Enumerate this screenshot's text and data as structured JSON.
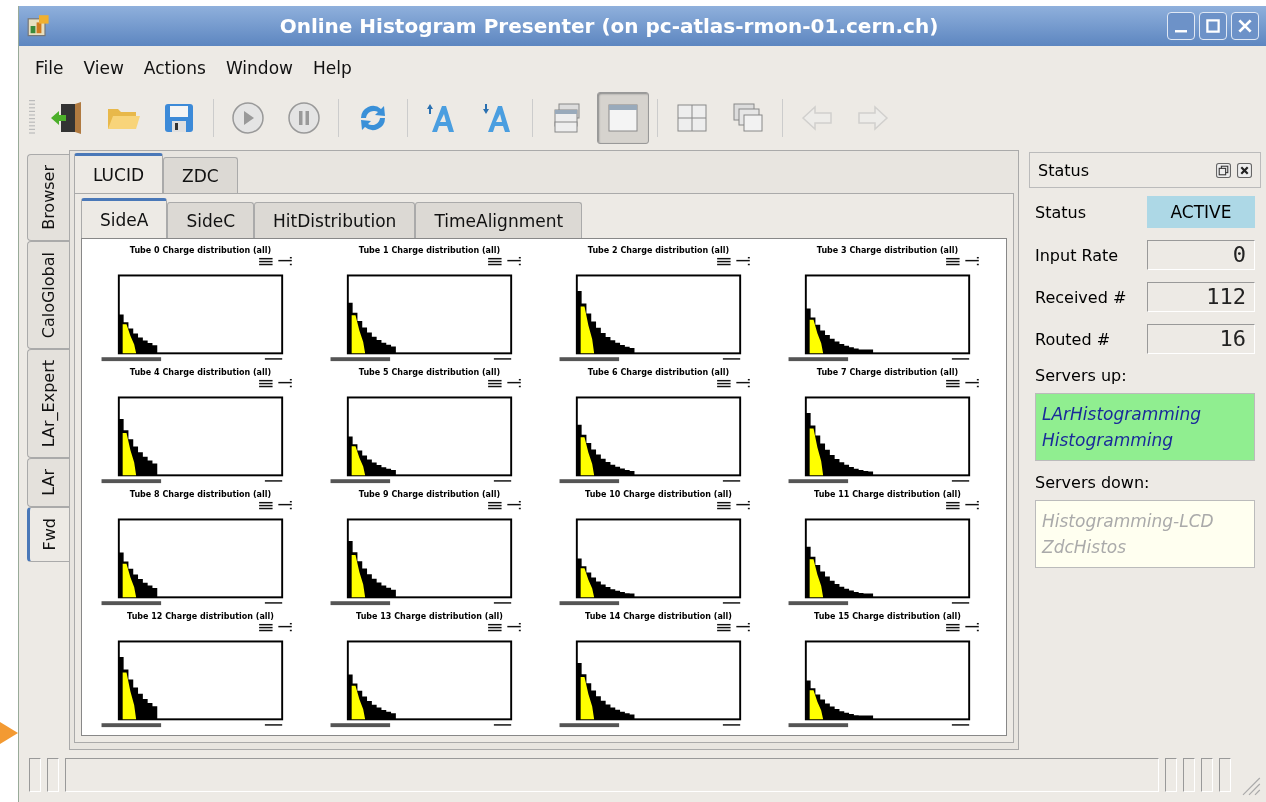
{
  "window": {
    "title": "Online Histogram Presenter (on pc-atlas-rmon-01.cern.ch)"
  },
  "menu": [
    "File",
    "View",
    "Actions",
    "Window",
    "Help"
  ],
  "toolbar": [
    {
      "kind": "exit",
      "pressed": false,
      "disabled": false
    },
    {
      "kind": "open",
      "pressed": false,
      "disabled": false
    },
    {
      "kind": "save",
      "pressed": false,
      "disabled": false
    },
    {
      "kind": "sep"
    },
    {
      "kind": "play",
      "pressed": false,
      "disabled": false
    },
    {
      "kind": "pause",
      "pressed": false,
      "disabled": false
    },
    {
      "kind": "sep"
    },
    {
      "kind": "refresh",
      "pressed": false,
      "disabled": false
    },
    {
      "kind": "sep"
    },
    {
      "kind": "fontup",
      "pressed": false,
      "disabled": false
    },
    {
      "kind": "fontdown",
      "pressed": false,
      "disabled": false
    },
    {
      "kind": "sep"
    },
    {
      "kind": "stack",
      "pressed": false,
      "disabled": false
    },
    {
      "kind": "single",
      "pressed": true,
      "disabled": false
    },
    {
      "kind": "sep"
    },
    {
      "kind": "tile",
      "pressed": false,
      "disabled": false
    },
    {
      "kind": "cascade",
      "pressed": false,
      "disabled": false
    },
    {
      "kind": "sep"
    },
    {
      "kind": "back",
      "pressed": false,
      "disabled": true
    },
    {
      "kind": "forward",
      "pressed": false,
      "disabled": true
    }
  ],
  "side_tabs": [
    {
      "label": "Browser",
      "selected": false
    },
    {
      "label": "CaloGlobal",
      "selected": false
    },
    {
      "label": "LAr_Expert",
      "selected": false
    },
    {
      "label": "LAr",
      "selected": false
    },
    {
      "label": "Fwd",
      "selected": true
    }
  ],
  "tabs": [
    {
      "label": "LUCID",
      "selected": true
    },
    {
      "label": "ZDC",
      "selected": false
    }
  ],
  "sub_tabs": [
    {
      "label": "SideA",
      "selected": true
    },
    {
      "label": "SideC",
      "selected": false
    },
    {
      "label": "HitDistribution",
      "selected": false
    },
    {
      "label": "TimeAlignment",
      "selected": false
    }
  ],
  "histograms": [
    {
      "title": "Tube 0 Charge distribution (all)"
    },
    {
      "title": "Tube 1 Charge distribution (all)"
    },
    {
      "title": "Tube 2 Charge distribution (all)"
    },
    {
      "title": "Tube 3 Charge distribution (all)"
    },
    {
      "title": "Tube 4 Charge distribution (all)"
    },
    {
      "title": "Tube 5 Charge distribution (all)"
    },
    {
      "title": "Tube 6 Charge distribution (all)"
    },
    {
      "title": "Tube 7 Charge distribution (all)"
    },
    {
      "title": "Tube 8 Charge distribution (all)"
    },
    {
      "title": "Tube 9 Charge distribution (all)"
    },
    {
      "title": "Tube 10 Charge distribution (all)"
    },
    {
      "title": "Tube 11 Charge distribution (all)"
    },
    {
      "title": "Tube 12 Charge distribution (all)"
    },
    {
      "title": "Tube 13 Charge distribution (all)"
    },
    {
      "title": "Tube 14 Charge distribution (all)"
    },
    {
      "title": "Tube 15 Charge distribution (all)"
    }
  ],
  "status_panel": {
    "title": "Status",
    "rows": [
      {
        "label": "Status",
        "value": "ACTIVE",
        "kind": "badge"
      },
      {
        "label": "Input Rate",
        "value": "0",
        "kind": "lcd"
      },
      {
        "label": "Received #",
        "value": "112",
        "kind": "lcd"
      },
      {
        "label": "Routed #",
        "value": "16",
        "kind": "lcd"
      }
    ],
    "servers_up_label": "Servers up:",
    "servers_up": [
      "LArHistogramming",
      "Histogramming"
    ],
    "servers_down_label": "Servers down:",
    "servers_down": [
      "Histogramming-LCD",
      "ZdcHistos"
    ]
  }
}
